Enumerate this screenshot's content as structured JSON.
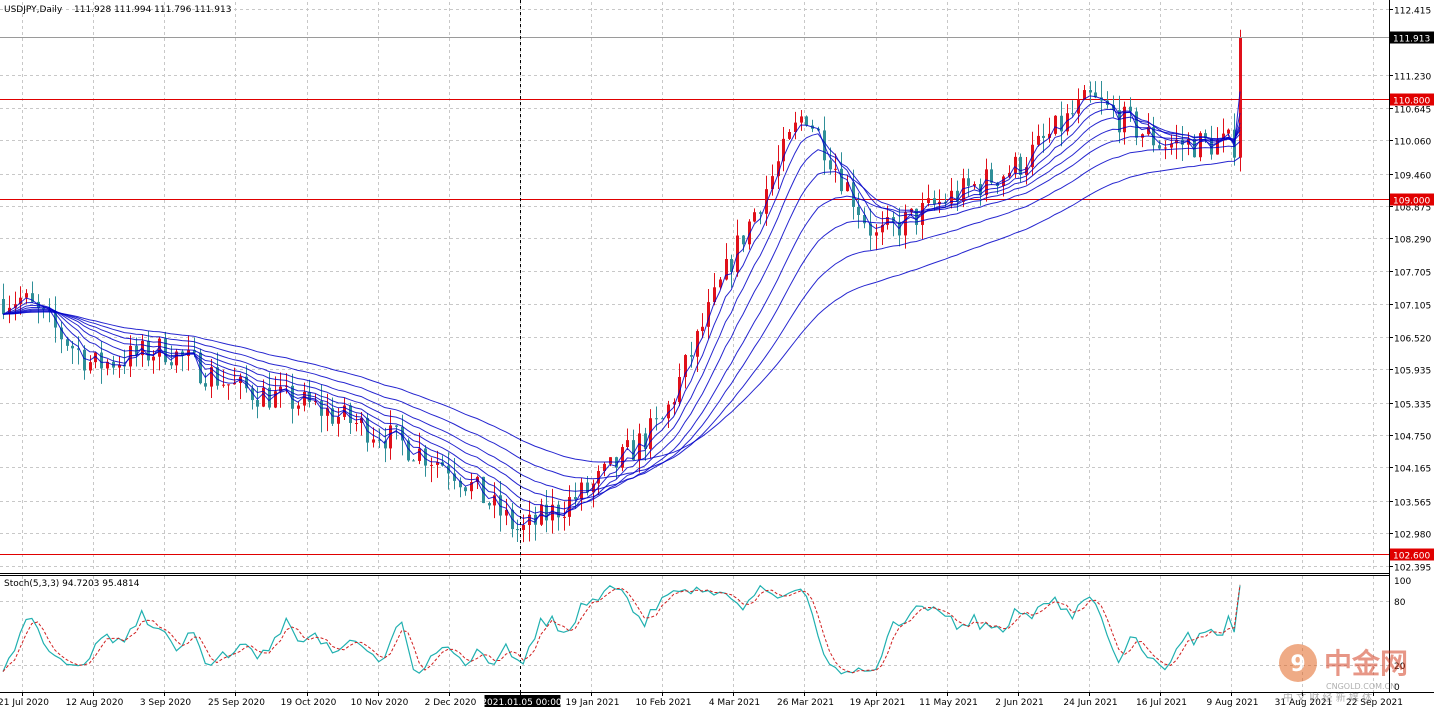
{
  "header": {
    "symbol_label": "USDJPY,Daily",
    "ohlc": "111.928 111.994 111.796 111.913"
  },
  "stoch_header": "Stoch(5,3,3) 94.7203 95.4814",
  "watermark": {
    "brand_cn": "中金网",
    "domain": "CNGOLD.COM.CN",
    "slogan": "中 文 财 经 新 媒 体",
    "logo_glyph": "9"
  },
  "colors": {
    "bull": "#e0101a",
    "bear": "#2f8f98",
    "ma": "#0000c8",
    "hline": "#e00000",
    "stoch_main": "#20b0b0",
    "stoch_signal": "#d02020",
    "grid": "#c8c8c8"
  },
  "chart_data": {
    "type": "candlestick",
    "title": "USDJPY,Daily",
    "price_axis": {
      "ticks": [
        "112.415",
        "111.230",
        "110.645",
        "110.060",
        "109.460",
        "108.875",
        "108.290",
        "107.705",
        "107.105",
        "106.520",
        "105.935",
        "105.335",
        "104.750",
        "104.165",
        "103.565",
        "102.980",
        "102.395"
      ],
      "ylim": [
        102.3,
        112.55
      ],
      "current_price": "111.913"
    },
    "time_axis": {
      "labels": [
        "21 Jul 2020",
        "12 Aug 2020",
        "3 Sep 2020",
        "25 Sep 2020",
        "19 Oct 2020",
        "10 Nov 2020",
        "2 Dec 2020",
        "2021.01.05 00:00",
        "19 Jan 2021",
        "10 Feb 2021",
        "4 Mar 2021",
        "26 Mar 2021",
        "19 Apr 2021",
        "11 May 2021",
        "2 Jun 2021",
        "24 Jun 2021",
        "16 Jul 2021",
        "9 Aug 2021",
        "31 Aug 2021",
        "22 Sep 2021"
      ],
      "highlighted": "2021.01.05 00:00"
    },
    "horizontal_lines": [
      {
        "price": 110.8,
        "label": "110.800"
      },
      {
        "price": 109.0,
        "label": "109.000"
      },
      {
        "price": 102.6,
        "label": "102.600"
      }
    ],
    "close_path": {
      "dates": [
        "21 Jul 2020",
        "12 Aug 2020",
        "3 Sep 2020",
        "25 Sep 2020",
        "19 Oct 2020",
        "10 Nov 2020",
        "2 Dec 2020",
        "2021.01.05 00:00",
        "19 Jan 2021",
        "10 Feb 2021",
        "4 Mar 2021",
        "26 Mar 2021",
        "19 Apr 2021",
        "11 May 2021",
        "2 Jun 2021",
        "24 Jun 2021",
        "16 Jul 2021",
        "9 Aug 2021",
        "31 Aug 2021",
        "22 Sep 2021"
      ],
      "closes": [
        107.2,
        106.0,
        106.3,
        105.6,
        105.3,
        104.8,
        104.2,
        103.0,
        103.8,
        105.0,
        108.0,
        110.6,
        108.3,
        109.0,
        109.6,
        110.8,
        110.0,
        110.0,
        110.0,
        111.913
      ]
    },
    "moving_averages": {
      "count": 8,
      "description": "Guppy-style ribbon"
    },
    "indicator": {
      "name": "Stoch(5,3,3)",
      "main": 94.7203,
      "signal": 95.4814,
      "levels": [
        "100",
        "80",
        "20",
        "0"
      ],
      "ylim": [
        0,
        100
      ]
    }
  }
}
